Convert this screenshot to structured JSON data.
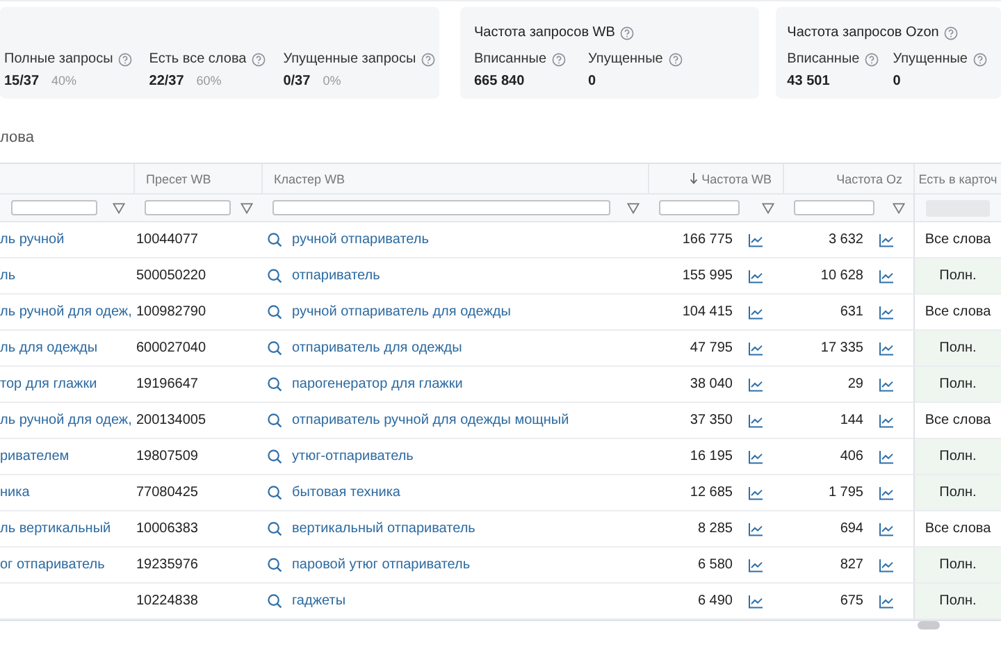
{
  "summary_cards": [
    {
      "metrics": [
        {
          "label": "Полные запросы",
          "value": "15/37",
          "share": "40%"
        },
        {
          "label": "Есть все слова",
          "value": "22/37",
          "share": "60%"
        },
        {
          "label": "Упущенные запросы",
          "value": "0/37",
          "share": "0%"
        }
      ]
    },
    {
      "title": "Частота запросов WB",
      "metrics": [
        {
          "label": "Вписанные",
          "value": "665 840"
        },
        {
          "label": "Упущенные",
          "value": "0"
        }
      ]
    },
    {
      "title": "Частота запросов Ozon",
      "metrics": [
        {
          "label": "Вписанные",
          "value": "43 501"
        },
        {
          "label": "Упущенные",
          "value": "0"
        }
      ]
    }
  ],
  "section_title": "лова",
  "table": {
    "columns": [
      {
        "sorted": false,
        "filter": true
      },
      {
        "label": "Пресет WB",
        "sorted": false,
        "filter": true
      },
      {
        "label": "Кластер WB",
        "sorted": false,
        "filter": true
      },
      {
        "label": "Частота WB",
        "sorted": true,
        "filter": true
      },
      {
        "label": "Частота Oz",
        "sorted": false,
        "filter": true
      },
      {
        "label": "Есть в карточ",
        "sorted": false,
        "filter": false
      }
    ],
    "rows": [
      {
        "query": "ль ручной",
        "preset": "10044077",
        "cluster": "ручной отпариватель",
        "freq_wb": "166 775",
        "freq_oz": "3 632",
        "kind": "all_words",
        "match_text": "Все слова"
      },
      {
        "query": "ль",
        "preset": "500050220",
        "cluster": "отпариватель",
        "freq_wb": "155 995",
        "freq_oz": "10 628",
        "kind": "full",
        "match_text": "Полн."
      },
      {
        "query": "ль ручной для одеж,",
        "preset": "100982790",
        "cluster": "ручной отпариватель для одежды",
        "freq_wb": "104 415",
        "freq_oz": "631",
        "kind": "all_words",
        "match_text": "Все слова"
      },
      {
        "query": "ль для одежды",
        "preset": "600027040",
        "cluster": "отпариватель для одежды",
        "freq_wb": "47 795",
        "freq_oz": "17 335",
        "kind": "full",
        "match_text": "Полн."
      },
      {
        "query": "тор для глажки",
        "preset": "19196647",
        "cluster": "парогенератор для глажки",
        "freq_wb": "38 040",
        "freq_oz": "29",
        "kind": "full",
        "match_text": "Полн."
      },
      {
        "query": "ль ручной для одеж,",
        "preset": "200134005",
        "cluster": "отпариватель ручной для одежды мощный",
        "freq_wb": "37 350",
        "freq_oz": "144",
        "kind": "all_words",
        "match_text": "Все слова"
      },
      {
        "query": "ривателем",
        "preset": "19807509",
        "cluster": "утюг-отпариватель",
        "freq_wb": "16 195",
        "freq_oz": "406",
        "kind": "full",
        "match_text": "Полн."
      },
      {
        "query": "ника",
        "preset": "77080425",
        "cluster": "бытовая техника",
        "freq_wb": "12 685",
        "freq_oz": "1 795",
        "kind": "full",
        "match_text": "Полн."
      },
      {
        "query": "ль вертикальный",
        "preset": "10006383",
        "cluster": "вертикальный отпариватель",
        "freq_wb": "8 285",
        "freq_oz": "694",
        "kind": "all_words",
        "match_text": "Все слова"
      },
      {
        "query": "ог отпариватель",
        "preset": "19235976",
        "cluster": "паровой утюг отпариватель",
        "freq_wb": "6 580",
        "freq_oz": "827",
        "kind": "full",
        "match_text": "Полн."
      },
      {
        "preset": "10224838",
        "cluster": "гаджеты",
        "freq_wb": "6 490",
        "freq_oz": "675",
        "kind": "full",
        "match_text": "Полн."
      }
    ]
  }
}
